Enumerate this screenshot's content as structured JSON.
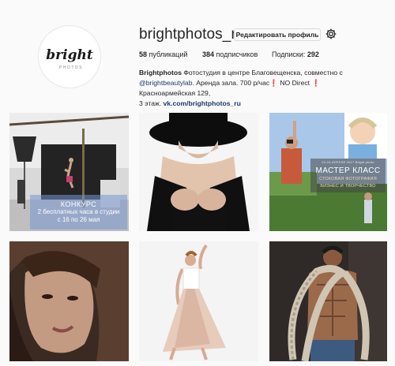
{
  "profile": {
    "username": "brightphotos_ru",
    "edit_label": "Редактировать профиль",
    "logo_text": "bright",
    "logo_sub": "PHOTOS",
    "stats": {
      "posts_count": "58",
      "posts_label": "публикаций",
      "followers_count": "384",
      "followers_label": "подписчиков",
      "following_label": "Подписки:",
      "following_count": "292"
    },
    "bio": {
      "name": "Brightphotos",
      "line1": "Фотостудия в центре Благовещенска, совместно с",
      "mention": "@brightbeautylab",
      "line2a": ". Аренда зала. 700 р/час",
      "mark1": "❗",
      "line2b": " NO Direct ",
      "mark2": "❗",
      "line2c": " Красноармейская 129,",
      "line3": "3 этаж.",
      "link": "vk.com/brightphotos_ru"
    }
  },
  "posts": [
    {
      "alt": "studio",
      "overlay_title": "КОНКУРС",
      "overlay_line1": "2 бесплатных часа в студии",
      "overlay_line2": "с 16 по 26 мая"
    },
    {
      "alt": "portrait-hat"
    },
    {
      "alt": "masterclass",
      "overlay_small": "22-23 АПРЕЛЯ 2017 Bright photo",
      "overlay_title": "МАСТЕР КЛАСС",
      "overlay_sub1": "СТОКОВАЯ ФОТОГРАФИЯ",
      "overlay_sub2": "БИЗНЕС И ТВОРЧЕСТВО"
    },
    {
      "alt": "portrait-face"
    },
    {
      "alt": "dancer"
    },
    {
      "alt": "athlete-rope"
    }
  ],
  "colors": {
    "background": "#fafafa",
    "link": "#1b3a6b",
    "alert": "#e02020"
  },
  "icons": {
    "settings": "gear-icon"
  }
}
